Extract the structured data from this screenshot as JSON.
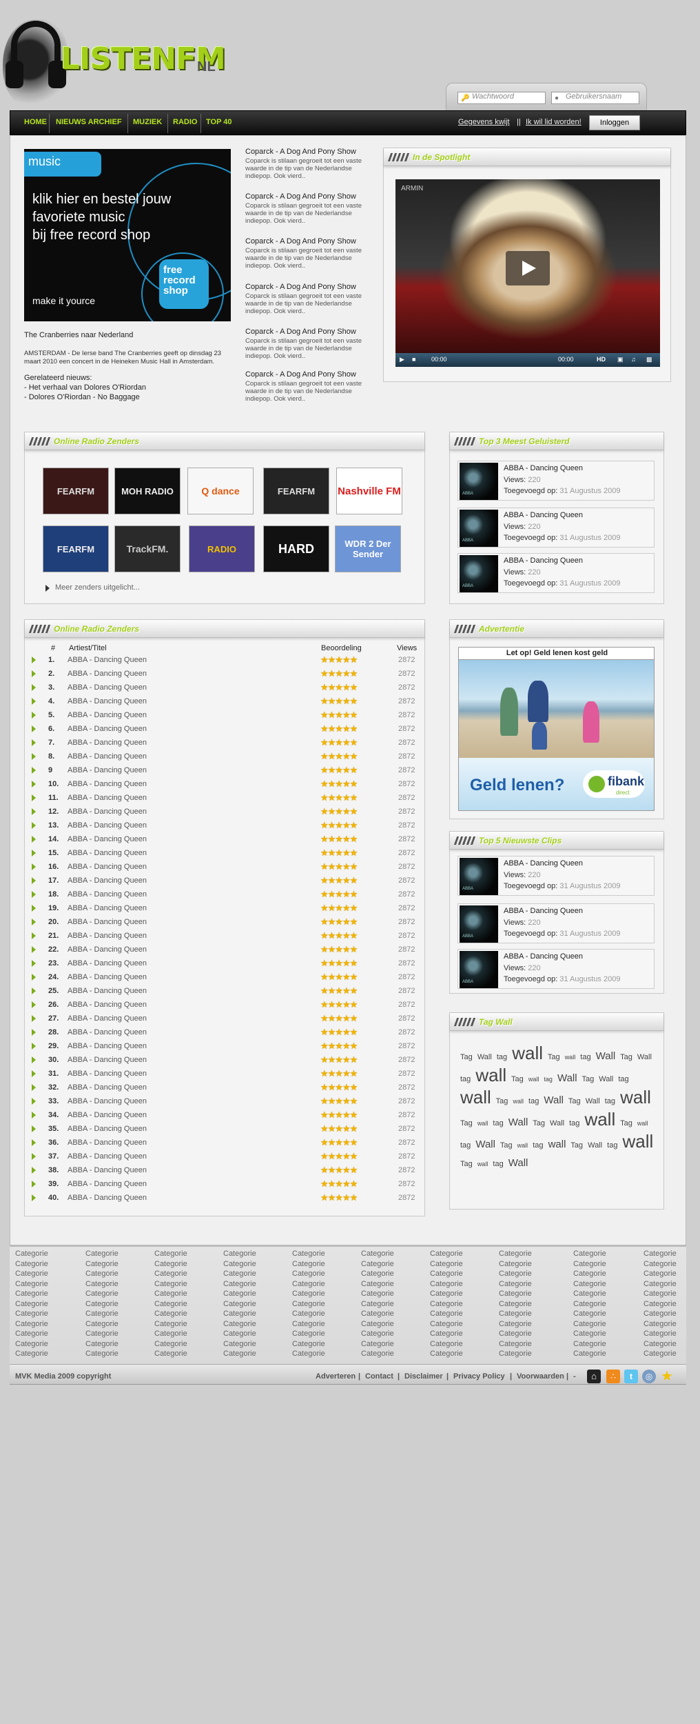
{
  "header": {
    "logo_text": "LISTENFM",
    "logo_suffix": "NL",
    "password_placeholder": "Wachtwoord",
    "username_placeholder": "Gebruikersnaam"
  },
  "nav": {
    "items": [
      "HOME",
      "NIEUWS ARCHIEF",
      "MUZIEK",
      "RADIO",
      "TOP 40"
    ],
    "forgot_label": "Gegevens kwijt",
    "separator": "||",
    "register_label": "Ik wil lid worden!",
    "login_button": "Inloggen"
  },
  "banner": {
    "tag": "music",
    "line1": "klik hier en bestel jouw",
    "line2": "favoriete music",
    "line3": "bij free record shop",
    "badge": "free record shop",
    "slogan": "make it yource"
  },
  "featured": {
    "heading": "The Cranberries naar Nederland",
    "body": "AMSTERDAM - De Ierse band The Cranberries geeft op dinsdag 23 maart 2010 een concert in de Heineken Music Hall in Amsterdam.",
    "related_label": "Gerelateerd nieuws:",
    "related": [
      "- Het verhaal van Dolores O'Riordan",
      "- Dolores O'Riordan - No Baggage"
    ]
  },
  "articles": [
    {
      "title": "Coparck - A Dog And Pony Show",
      "desc": "Coparck is stilaan gegroeit tot een vaste waarde in de tip van de Nederlandse indiepop. Ook vierd.."
    },
    {
      "title": "Coparck - A Dog And Pony Show",
      "desc": "Coparck is stilaan gegroeit tot een vaste waarde in de tip van de Nederlandse indiepop. Ook vierd.."
    },
    {
      "title": "Coparck - A Dog And Pony Show",
      "desc": "Coparck is stilaan gegroeit tot een vaste waarde in de tip van de Nederlandse indiepop. Ook vierd.."
    },
    {
      "title": "Coparck - A Dog And Pony Show",
      "desc": "Coparck is stilaan gegroeit tot een vaste waarde in de tip van de Nederlandse indiepop. Ook vierd.."
    },
    {
      "title": "Coparck - A Dog And Pony Show",
      "desc": "Coparck is stilaan gegroeit tot een vaste waarde in de tip van de Nederlandse indiepop. Ook vierd.."
    },
    {
      "title": "Coparck - A Dog And Pony Show",
      "desc": "Coparck is stilaan gegroeit tot een vaste waarde in de tip van de Nederlandse indiepop. Ook vierd.."
    }
  ],
  "spotlight": {
    "title": "In de Spotlight",
    "video_logo": "ARMIN",
    "time_elapsed": "00:00",
    "time_total": "00:00",
    "hd_label": "HD"
  },
  "radio_box": {
    "title": "Online Radio Zenders",
    "stations": [
      "FEARFM",
      "MOH RADIO",
      "Q dance",
      "FEARFM",
      "Nashville FM",
      "FEARFM",
      "TrackFM.",
      "RADIO",
      "HARD",
      "WDR 2 Der Sender"
    ],
    "more_link": "Meer zenders uitgelicht..."
  },
  "top3": {
    "title": "Top 3 Meest Geluisterd",
    "clips": [
      {
        "name": "ABBA - Dancing Queen",
        "views_label": "Views:",
        "views": "220",
        "added_label": "Toegevoegd op:",
        "added": "31 Augustus 2009"
      },
      {
        "name": "ABBA - Dancing Queen",
        "views_label": "Views:",
        "views": "220",
        "added_label": "Toegevoegd op:",
        "added": "31 Augustus 2009"
      },
      {
        "name": "ABBA - Dancing Queen",
        "views_label": "Views:",
        "views": "220",
        "added_label": "Toegevoegd op:",
        "added": "31 Augustus 2009"
      }
    ]
  },
  "chart": {
    "title": "Online Radio Zenders",
    "col_hash": "#",
    "col_title": "Artiest/Titel",
    "col_rating": "Beoordeling",
    "col_views": "Views",
    "rows": [
      {
        "num": "1.",
        "title": "ABBA - Dancing Queen",
        "rating": 5,
        "views": "2872"
      },
      {
        "num": "2.",
        "title": "ABBA - Dancing Queen",
        "rating": 5,
        "views": "2872"
      },
      {
        "num": "3.",
        "title": "ABBA - Dancing Queen",
        "rating": 5,
        "views": "2872"
      },
      {
        "num": "4.",
        "title": "ABBA - Dancing Queen",
        "rating": 5,
        "views": "2872"
      },
      {
        "num": "5.",
        "title": "ABBA - Dancing Queen",
        "rating": 5,
        "views": "2872"
      },
      {
        "num": "6.",
        "title": "ABBA - Dancing Queen",
        "rating": 5,
        "views": "2872"
      },
      {
        "num": "7.",
        "title": "ABBA - Dancing Queen",
        "rating": 5,
        "views": "2872"
      },
      {
        "num": "8.",
        "title": "ABBA - Dancing Queen",
        "rating": 5,
        "views": "2872"
      },
      {
        "num": "9",
        "title": "ABBA - Dancing Queen",
        "rating": 5,
        "views": "2872"
      },
      {
        "num": "10.",
        "title": "ABBA - Dancing Queen",
        "rating": 5,
        "views": "2872"
      },
      {
        "num": "11.",
        "title": "ABBA - Dancing Queen",
        "rating": 5,
        "views": "2872"
      },
      {
        "num": "12.",
        "title": "ABBA - Dancing Queen",
        "rating": 5,
        "views": "2872"
      },
      {
        "num": "13.",
        "title": "ABBA - Dancing Queen",
        "rating": 5,
        "views": "2872"
      },
      {
        "num": "14.",
        "title": "ABBA - Dancing Queen",
        "rating": 5,
        "views": "2872"
      },
      {
        "num": "15.",
        "title": "ABBA - Dancing Queen",
        "rating": 5,
        "views": "2872"
      },
      {
        "num": "16.",
        "title": "ABBA - Dancing Queen",
        "rating": 5,
        "views": "2872"
      },
      {
        "num": "17.",
        "title": "ABBA - Dancing Queen",
        "rating": 5,
        "views": "2872"
      },
      {
        "num": "18.",
        "title": "ABBA - Dancing Queen",
        "rating": 5,
        "views": "2872"
      },
      {
        "num": "19.",
        "title": "ABBA - Dancing Queen",
        "rating": 5,
        "views": "2872"
      },
      {
        "num": "20.",
        "title": "ABBA - Dancing Queen",
        "rating": 5,
        "views": "2872"
      },
      {
        "num": "21.",
        "title": "ABBA - Dancing Queen",
        "rating": 5,
        "views": "2872"
      },
      {
        "num": "22.",
        "title": "ABBA - Dancing Queen",
        "rating": 5,
        "views": "2872"
      },
      {
        "num": "23.",
        "title": "ABBA - Dancing Queen",
        "rating": 5,
        "views": "2872"
      },
      {
        "num": "24.",
        "title": "ABBA - Dancing Queen",
        "rating": 5,
        "views": "2872"
      },
      {
        "num": "25.",
        "title": "ABBA - Dancing Queen",
        "rating": 5,
        "views": "2872"
      },
      {
        "num": "26.",
        "title": "ABBA - Dancing Queen",
        "rating": 5,
        "views": "2872"
      },
      {
        "num": "27.",
        "title": "ABBA - Dancing Queen",
        "rating": 5,
        "views": "2872"
      },
      {
        "num": "28.",
        "title": "ABBA - Dancing Queen",
        "rating": 5,
        "views": "2872"
      },
      {
        "num": "29.",
        "title": "ABBA - Dancing Queen",
        "rating": 5,
        "views": "2872"
      },
      {
        "num": "30.",
        "title": "ABBA - Dancing Queen",
        "rating": 5,
        "views": "2872"
      },
      {
        "num": "31.",
        "title": "ABBA - Dancing Queen",
        "rating": 5,
        "views": "2872"
      },
      {
        "num": "32.",
        "title": "ABBA - Dancing Queen",
        "rating": 5,
        "views": "2872"
      },
      {
        "num": "33.",
        "title": "ABBA - Dancing Queen",
        "rating": 5,
        "views": "2872"
      },
      {
        "num": "34.",
        "title": "ABBA - Dancing Queen",
        "rating": 5,
        "views": "2872"
      },
      {
        "num": "35.",
        "title": "ABBA - Dancing Queen",
        "rating": 5,
        "views": "2872"
      },
      {
        "num": "36.",
        "title": "ABBA - Dancing Queen",
        "rating": 5,
        "views": "2872"
      },
      {
        "num": "37.",
        "title": "ABBA - Dancing Queen",
        "rating": 5,
        "views": "2872"
      },
      {
        "num": "38.",
        "title": "ABBA - Dancing Queen",
        "rating": 5,
        "views": "2872"
      },
      {
        "num": "39.",
        "title": "ABBA - Dancing Queen",
        "rating": 5,
        "views": "2872"
      },
      {
        "num": "40.",
        "title": "ABBA - Dancing Queen",
        "rating": 5,
        "views": "2872"
      }
    ]
  },
  "advert": {
    "title": "Advertentie",
    "top_text": "Let op! Geld lenen kost geld",
    "slogan": "Geld lenen?",
    "brand": "fibank",
    "brand_sub": "direct"
  },
  "top5": {
    "title": "Top 5 Nieuwste Clips",
    "clips": [
      {
        "name": "ABBA - Dancing Queen",
        "views_label": "Views:",
        "views": "220",
        "added_label": "Toegevoegd op:",
        "added": "31 Augustus 2009"
      },
      {
        "name": "ABBA - Dancing Queen",
        "views_label": "Views:",
        "views": "220",
        "added_label": "Toegevoegd op:",
        "added": "31 Augustus 2009"
      },
      {
        "name": "ABBA - Dancing Queen",
        "views_label": "Views:",
        "views": "220",
        "added_label": "Toegevoegd op:",
        "added": "31 Augustus 2009"
      }
    ]
  },
  "tagwall": {
    "title": "Tag Wall",
    "words": [
      {
        "t": "Tag",
        "s": 11
      },
      {
        "t": "Wall",
        "s": 11
      },
      {
        "t": "tag",
        "s": 11
      },
      {
        "t": "wall",
        "s": 26
      },
      {
        "t": "Tag",
        "s": 11
      },
      {
        "t": "wall",
        "s": 9
      },
      {
        "t": "tag",
        "s": 11
      },
      {
        "t": "Wall",
        "s": 15
      },
      {
        "t": "Tag",
        "s": 11
      },
      {
        "t": "Wall",
        "s": 11
      },
      {
        "t": "tag",
        "s": 11
      },
      {
        "t": "wall",
        "s": 26
      },
      {
        "t": "Tag",
        "s": 11
      },
      {
        "t": "wall",
        "s": 9
      },
      {
        "t": "tag",
        "s": 9
      },
      {
        "t": "Wall",
        "s": 15
      },
      {
        "t": "Tag",
        "s": 11
      },
      {
        "t": "Wall",
        "s": 11
      },
      {
        "t": "tag",
        "s": 11
      },
      {
        "t": "wall",
        "s": 26
      },
      {
        "t": "Tag",
        "s": 11
      },
      {
        "t": "wall",
        "s": 9
      },
      {
        "t": "tag",
        "s": 11
      },
      {
        "t": "Wall",
        "s": 15
      },
      {
        "t": "Tag",
        "s": 11
      },
      {
        "t": "Wall",
        "s": 11
      },
      {
        "t": "tag",
        "s": 11
      },
      {
        "t": "wall",
        "s": 26
      },
      {
        "t": "Tag",
        "s": 11
      },
      {
        "t": "wall",
        "s": 9
      },
      {
        "t": "tag",
        "s": 11
      },
      {
        "t": "Wall",
        "s": 15
      },
      {
        "t": "Tag",
        "s": 11
      },
      {
        "t": "Wall",
        "s": 11
      },
      {
        "t": "tag",
        "s": 11
      },
      {
        "t": "wall",
        "s": 26
      },
      {
        "t": "Tag",
        "s": 11
      },
      {
        "t": "wall",
        "s": 9
      },
      {
        "t": "tag",
        "s": 11
      },
      {
        "t": "Wall",
        "s": 15
      },
      {
        "t": "Tag",
        "s": 11
      },
      {
        "t": "wall",
        "s": 9
      },
      {
        "t": "tag",
        "s": 11
      },
      {
        "t": "wall",
        "s": 15
      },
      {
        "t": "Tag",
        "s": 11
      },
      {
        "t": "Wall",
        "s": 11
      },
      {
        "t": "tag",
        "s": 11
      },
      {
        "t": "wall",
        "s": 26
      },
      {
        "t": "Tag",
        "s": 11
      },
      {
        "t": "wall",
        "s": 9
      },
      {
        "t": "tag",
        "s": 11
      },
      {
        "t": "Wall",
        "s": 15
      }
    ]
  },
  "footer": {
    "category_label": "Categorie",
    "copyright": "MVK Media 2009 copyright",
    "links": [
      "Adverteren",
      "Contact",
      "Disclaimer",
      "Privacy Policy",
      "Voorwaarden"
    ],
    "link_separator": "|",
    "trailing": "-"
  }
}
